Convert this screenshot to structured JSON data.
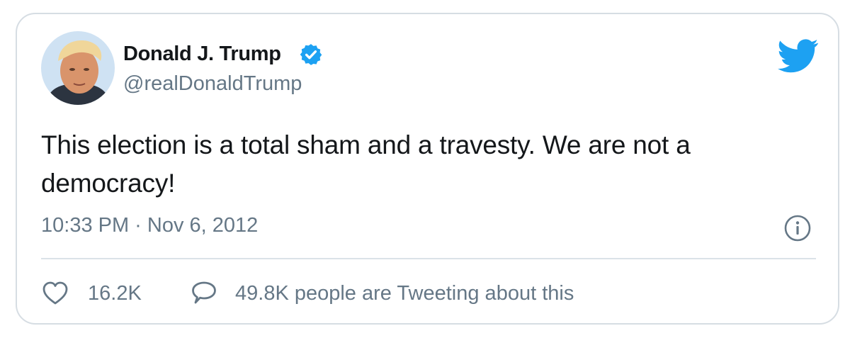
{
  "tweet": {
    "author": {
      "name": "Donald J. Trump",
      "handle": "@realDonaldTrump",
      "verified": true,
      "avatar_icon": "profile-photo"
    },
    "text": "This election is a total sham and a travesty. We are not a democracy!",
    "timestamp": "10:33 PM · Nov 6, 2012",
    "likes": "16.2K",
    "discussion": "49.8K people are Tweeting about this"
  },
  "icons": {
    "brand": "twitter-bird-icon",
    "verified": "verified-badge-icon",
    "info": "info-icon",
    "like": "heart-icon",
    "reply": "speech-bubble-icon"
  },
  "colors": {
    "brand": "#1da1f2",
    "text": "#14171a",
    "muted": "#657786",
    "border": "#d6dde3"
  }
}
